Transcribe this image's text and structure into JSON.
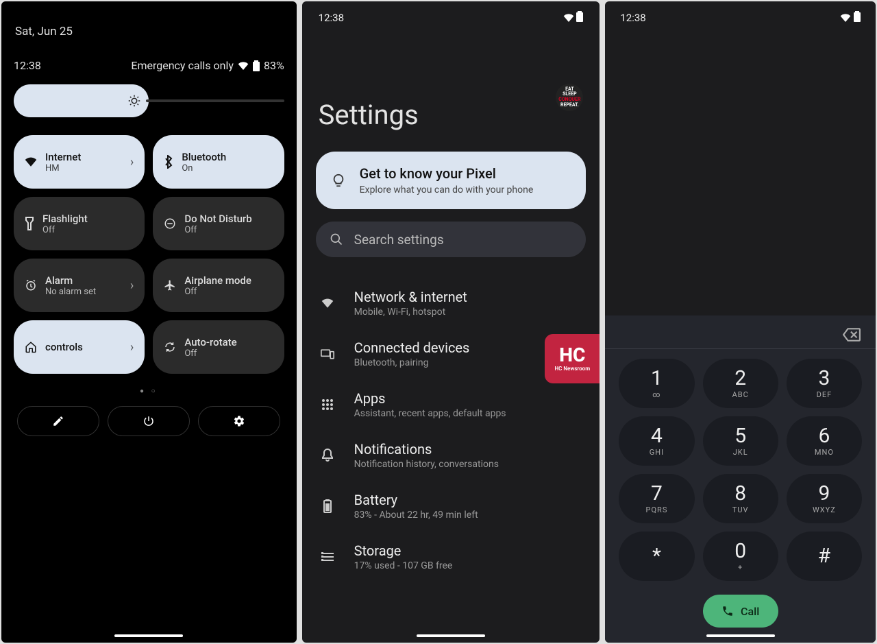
{
  "phone1": {
    "date": "Sat, Jun 25",
    "clock": "12:38",
    "status_text": "Emergency calls only",
    "battery": "83%",
    "tiles": [
      {
        "id": "internet",
        "title": "Internet",
        "sub": "HM",
        "state": "on",
        "chevron": true,
        "icon": "wifi-icon"
      },
      {
        "id": "bluetooth",
        "title": "Bluetooth",
        "sub": "On",
        "state": "on",
        "chevron": false,
        "icon": "bluetooth-icon"
      },
      {
        "id": "flashlight",
        "title": "Flashlight",
        "sub": "Off",
        "state": "off",
        "chevron": false,
        "icon": "flashlight-icon"
      },
      {
        "id": "dnd",
        "title": "Do Not Disturb",
        "sub": "Off",
        "state": "off",
        "chevron": false,
        "icon": "dnd-icon"
      },
      {
        "id": "alarm",
        "title": "Alarm",
        "sub": "No alarm set",
        "state": "off",
        "chevron": true,
        "icon": "alarm-icon"
      },
      {
        "id": "airplane",
        "title": "Airplane mode",
        "sub": "Off",
        "state": "off",
        "chevron": false,
        "icon": "airplane-icon"
      },
      {
        "id": "controls",
        "title": "controls",
        "sub": "",
        "state": "on",
        "chevron": true,
        "icon": "home-icon"
      },
      {
        "id": "autorotate",
        "title": "Auto-rotate",
        "sub": "Off",
        "state": "off",
        "chevron": false,
        "icon": "rotate-icon"
      }
    ]
  },
  "phone2": {
    "clock": "12:38",
    "title": "Settings",
    "avatar_lines": [
      "EAT",
      "SLEEP",
      "CONQUER",
      "REPEAT."
    ],
    "pixel_card": {
      "title": "Get to know your Pixel",
      "sub": "Explore what you can do with your phone"
    },
    "search_placeholder": "Search settings",
    "rows": [
      {
        "id": "network",
        "title": "Network & internet",
        "sub": "Mobile, Wi-Fi, hotspot",
        "icon": "wifi-icon"
      },
      {
        "id": "connected",
        "title": "Connected devices",
        "sub": "Bluetooth, pairing",
        "icon": "devices-icon"
      },
      {
        "id": "apps",
        "title": "Apps",
        "sub": "Assistant, recent apps, default apps",
        "icon": "apps-icon"
      },
      {
        "id": "notifications",
        "title": "Notifications",
        "sub": "Notification history, conversations",
        "icon": "bell-icon"
      },
      {
        "id": "battery",
        "title": "Battery",
        "sub": "83% - About 22 hr, 49 min left",
        "icon": "battery-icon"
      },
      {
        "id": "storage",
        "title": "Storage",
        "sub": "17% used - 107 GB free",
        "icon": "storage-icon"
      }
    ],
    "badge": {
      "big": "HC",
      "small": "HC Newsroom"
    }
  },
  "phone3": {
    "clock": "12:38",
    "keys": [
      {
        "d": "1",
        "l": "∞"
      },
      {
        "d": "2",
        "l": "ABC"
      },
      {
        "d": "3",
        "l": "DEF"
      },
      {
        "d": "4",
        "l": "GHI"
      },
      {
        "d": "5",
        "l": "JKL"
      },
      {
        "d": "6",
        "l": "MNO"
      },
      {
        "d": "7",
        "l": "PQRS"
      },
      {
        "d": "8",
        "l": "TUV"
      },
      {
        "d": "9",
        "l": "WXYZ"
      },
      {
        "d": "*",
        "l": ""
      },
      {
        "d": "0",
        "l": "+"
      },
      {
        "d": "#",
        "l": ""
      }
    ],
    "call_label": "Call"
  }
}
